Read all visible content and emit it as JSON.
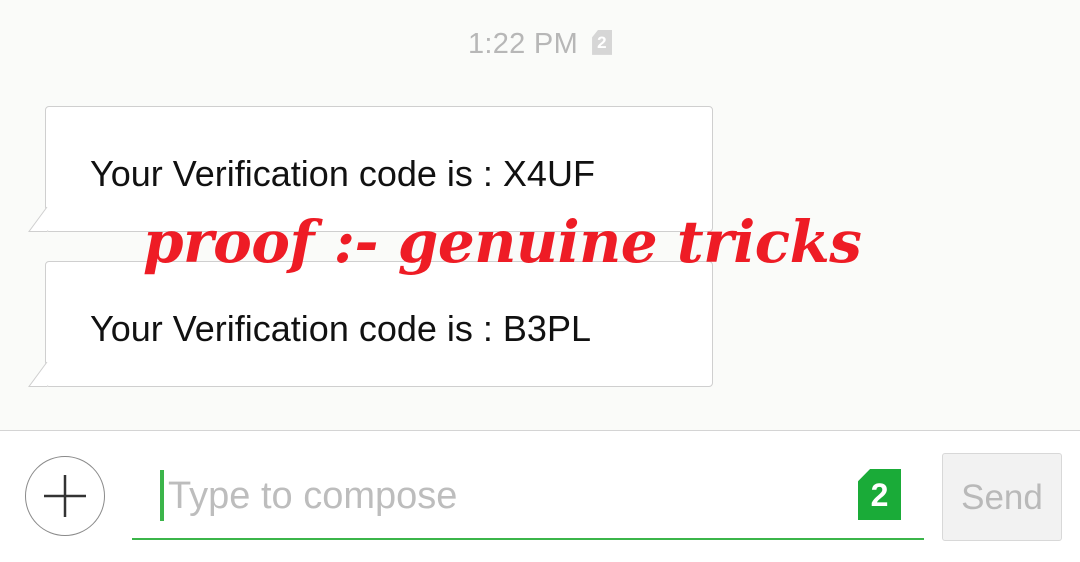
{
  "thread": {
    "timestamp": "1:22 PM",
    "timestamp_sim": "2",
    "messages": [
      {
        "text": "Your Verification code is : X4UF"
      },
      {
        "text": "Your Verification code is : B3PL"
      }
    ]
  },
  "overlay": {
    "watermark": "proof :- genuine tricks",
    "watermark_color": "#ee1c25"
  },
  "composer": {
    "placeholder": "Type to compose",
    "value": "",
    "sim_slot": "2",
    "send_label": "Send",
    "accent_color": "#3bb54a",
    "add_icon": "plus-icon"
  }
}
